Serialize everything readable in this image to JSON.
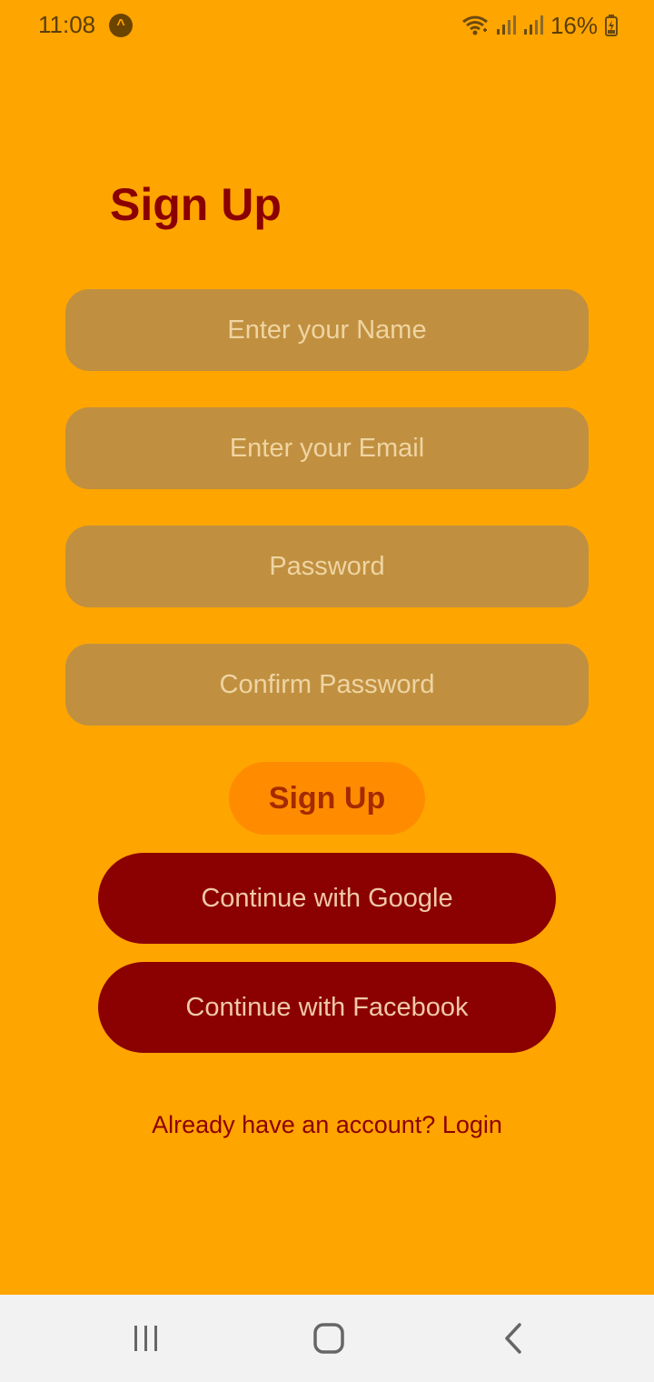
{
  "status_bar": {
    "time": "11:08",
    "app_icon": "expo-caret-icon",
    "battery_percent": "16%",
    "icons": [
      "wifi-icon",
      "signal-icon",
      "signal-icon",
      "battery-charging-icon"
    ]
  },
  "page": {
    "title": "Sign Up"
  },
  "form": {
    "name_placeholder": "Enter your Name",
    "email_placeholder": "Enter your Email",
    "password_placeholder": "Password",
    "confirm_password_placeholder": "Confirm Password",
    "signup_label": "Sign Up",
    "google_label": "Continue with Google",
    "facebook_label": "Continue with Facebook",
    "login_prompt": "Already have an account? Login"
  },
  "nav_bar": {
    "buttons": [
      "recents-icon",
      "home-icon",
      "back-icon"
    ]
  },
  "colors": {
    "background": "#FFA500",
    "title": "#8B0000",
    "field": "#C09040",
    "signup_button": "#FF8C00",
    "social_button": "#8B0000"
  }
}
